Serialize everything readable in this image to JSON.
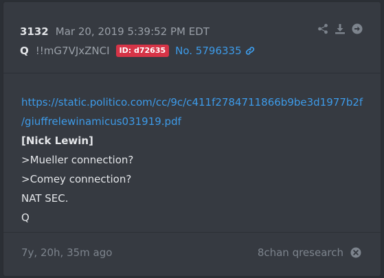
{
  "post": {
    "number": "3132",
    "date": "Mar 20, 2019 5:39:52 PM EDT",
    "author": "Q",
    "tripcode": "!!mG7VJxZNCI",
    "id_badge": "ID: d72635",
    "post_link": "No. 5796335",
    "actions": [
      "share-icon",
      "download-icon",
      "arrow-right-circle-icon"
    ]
  },
  "body": {
    "url_line1": "https://static.politico.com/cc/9c/c411f2784711866b9be3d1977b2f",
    "url_line2": "/giuffrelewinamicus031919.pdf",
    "bold_line": "[Nick Lewin]",
    "line3": ">Mueller connection?",
    "line4": ">Comey connection?",
    "line5": "NAT SEC.",
    "line6": "Q"
  },
  "footer": {
    "ago": "7y, 20h, 35m ago",
    "source": "8chan qresearch",
    "close_icon": "close-circle-icon"
  },
  "colors": {
    "background": "#363a41",
    "link": "#3d9be9",
    "badge": "#d63447",
    "text": "#e4e6e9",
    "muted": "#9aa0a8"
  }
}
